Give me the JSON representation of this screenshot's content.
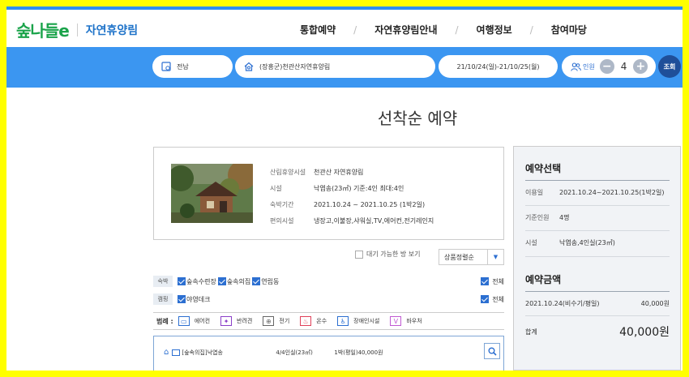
{
  "header": {
    "logo": "숲나들e",
    "site_name": "자연휴양림",
    "nav": [
      "통합예약",
      "자연휴양림안내",
      "여행정보",
      "참여마당"
    ]
  },
  "search": {
    "region": "전남",
    "forest": "(장흥군)천관산자연휴양림",
    "dates": "21/10/24(일)-21/10/25(월)",
    "person_label": "인원",
    "person_count": "4",
    "minus": "−",
    "plus": "+",
    "query": "조회"
  },
  "page_title": "선착순 예약",
  "facility": {
    "rows": [
      {
        "k": "산림휴양시설",
        "v": "천관산 자연휴양림"
      },
      {
        "k": "시설",
        "v": "낙엽송(23㎡) 기준:4인 최대:4인"
      },
      {
        "k": "숙박기간",
        "v": "2021.10.24 ~ 2021.10.25 (1박2일)"
      },
      {
        "k": "편의시설",
        "v": "냉장고,이불장,샤워실,TV,에어컨,전기레인지"
      }
    ]
  },
  "filters": {
    "waiting_label": "대기 가능한 방 보기",
    "sort": "상품정렬순"
  },
  "options": {
    "stay": {
      "tag": "숙박",
      "items": [
        "숲속수련장",
        "숲속의집",
        "연립동"
      ],
      "all": "전체"
    },
    "camp": {
      "tag": "캠핑",
      "items": [
        "야영데크"
      ],
      "all": "전체"
    }
  },
  "legend": {
    "label": "범례 :",
    "items": [
      {
        "icon": "air-conditioner-icon",
        "text": "에어컨",
        "color": "#2c6fd1"
      },
      {
        "icon": "pet-icon",
        "text": "반려견",
        "color": "#8a3fc8"
      },
      {
        "icon": "electric-icon",
        "text": "전기",
        "color": "#666666"
      },
      {
        "icon": "hot-spring-icon",
        "text": "온수",
        "color": "#e0405a"
      },
      {
        "icon": "accessible-icon",
        "text": "장애인시설",
        "color": "#2c6fd1"
      },
      {
        "icon": "voucher-icon",
        "text": "바우처",
        "color": "#c05ad2"
      }
    ]
  },
  "room": {
    "name": "[숲속의집]낙엽송",
    "size": "4/4인실(23㎡)",
    "price": "1박(평일)40,000원"
  },
  "sidebar": {
    "select_title": "예약선택",
    "rows": [
      {
        "k": "이용일",
        "v": "2021.10.24~2021.10.25(1박2일)"
      },
      {
        "k": "기준인원",
        "v": "4명"
      },
      {
        "k": "시설",
        "v": "낙엽송,4인실(23㎡)"
      }
    ],
    "amount_title": "예약금액",
    "amount_date": "2021.10.24(비수기/평일)",
    "amount_value": "40,000원",
    "total_label": "합계",
    "total_value": "40,000원"
  }
}
